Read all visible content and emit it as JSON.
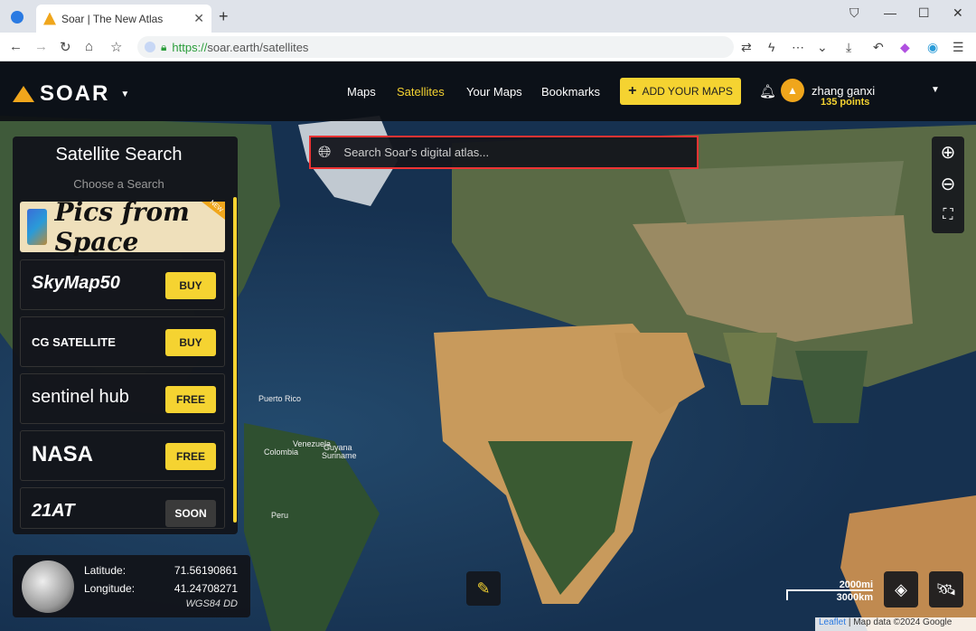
{
  "browser": {
    "tab_title": "Soar | The New Atlas",
    "url_protocol": "https://",
    "url_rest": "soar.earth/satellites"
  },
  "header": {
    "brand": "SOAR",
    "nav": [
      "Maps",
      "Satellites",
      "Your Maps",
      "Bookmarks"
    ],
    "active_nav": "Satellites",
    "add_maps_label": "ADD YOUR MAPS",
    "user_name": "zhang ganxi",
    "user_points": "135 points"
  },
  "search": {
    "placeholder": "Search Soar's digital atlas..."
  },
  "panel": {
    "title": "Satellite Search",
    "subtitle": "Choose a Search",
    "featured": {
      "label": "Pics from Space",
      "badge": "NEW"
    },
    "providers": [
      {
        "name": "SkyMap50",
        "action": "BUY"
      },
      {
        "name": "CG SATELLITE",
        "action": "BUY"
      },
      {
        "name": "sentinel hub",
        "action": "FREE"
      },
      {
        "name": "NASA",
        "action": "FREE"
      },
      {
        "name": "21AT",
        "action": "SOON"
      }
    ]
  },
  "coordinates": {
    "lat_label": "Latitude:",
    "lat_value": "71.56190861",
    "lon_label": "Longitude:",
    "lon_value": "41.24708271",
    "system": "WGS84 DD"
  },
  "map": {
    "scale_mi": "2000mi",
    "scale_km": "3000km",
    "attribution_leaflet": "Leaflet",
    "attribution_rest": "| Map data ©2024 Google",
    "labels": [
      "Puerto Rico",
      "Colombia",
      "Venezuela",
      "Guyana",
      "Suriname",
      "Peru"
    ]
  },
  "colors": {
    "accent": "#f5d331",
    "search_border": "#e33333",
    "header_bg": "#0c0e14"
  }
}
